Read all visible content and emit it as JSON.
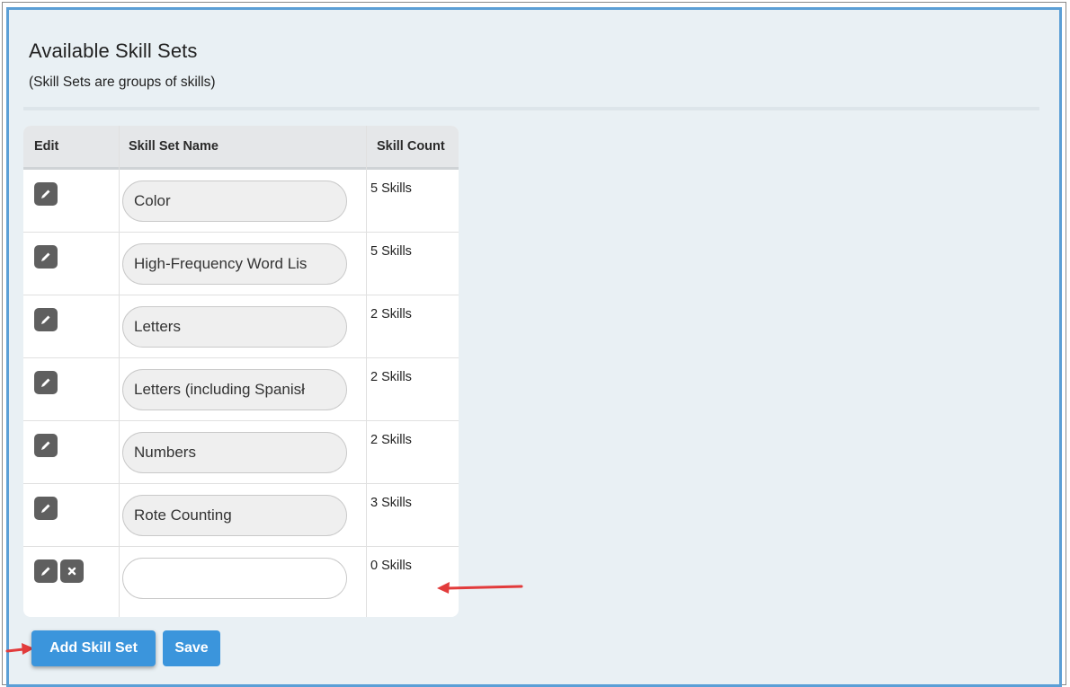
{
  "header": {
    "title": "Available Skill Sets",
    "subtitle": "(Skill Sets are groups of skills)"
  },
  "table": {
    "columns": [
      "Edit",
      "Skill Set Name",
      "Skill Count"
    ],
    "rows": [
      {
        "name": "Color",
        "count": "5 Skills"
      },
      {
        "name": "High-Frequency Word Lis",
        "count": "5 Skills"
      },
      {
        "name": "Letters",
        "count": "2 Skills"
      },
      {
        "name": "Letters (including Spanisł",
        "count": "2 Skills"
      },
      {
        "name": "Numbers",
        "count": "2 Skills"
      },
      {
        "name": "Rote Counting",
        "count": "3 Skills"
      },
      {
        "name": "",
        "count": "0 Skills"
      }
    ]
  },
  "buttons": {
    "add_label": "Add Skill Set",
    "save_label": "Save"
  },
  "icons": {
    "edit": "pencil-icon",
    "delete": "close-icon",
    "annotation": "arrow-icon"
  },
  "colors": {
    "accent": "#3b95dc",
    "panel_border": "#5b9fd6",
    "panel_bg": "#e9f0f4",
    "annotation_arrow": "#e23b3b"
  }
}
